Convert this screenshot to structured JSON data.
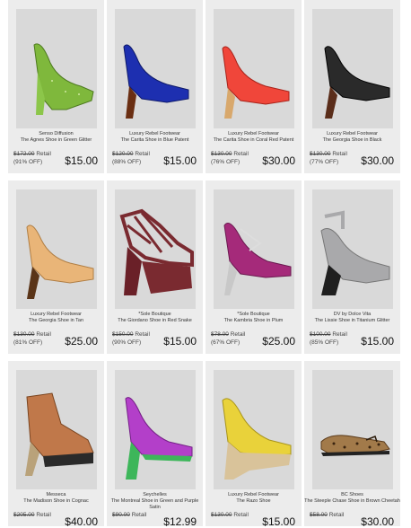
{
  "products": [
    {
      "brand": "Senso Diffusion",
      "name": "The Agnes Shoe in Green Glitter",
      "was": "$172.00",
      "retail_label": "Retail",
      "off": "(91% OFF)",
      "price": "$15.00",
      "shoe": "green-glitter-pump",
      "color": "#7fb83c"
    },
    {
      "brand": "Luxury Rebel Footwear",
      "name": "The Carita Shoe in Blue Patent",
      "was": "$120.00",
      "retail_label": "Retail",
      "off": "(88% OFF)",
      "price": "$15.00",
      "shoe": "blue-patent-pump",
      "color": "#1d2fb0"
    },
    {
      "brand": "Luxury Rebel Footwear",
      "name": "The Carita Shoe in Coral Red Patent",
      "was": "$130.00",
      "retail_label": "Retail",
      "off": "(76% OFF)",
      "price": "$30.00",
      "shoe": "coral-patent-pump",
      "color": "#f0463a"
    },
    {
      "brand": "Luxury Rebel Footwear",
      "name": "The Georgia Shoe in Black",
      "was": "$130.00",
      "retail_label": "Retail",
      "off": "(77% OFF)",
      "price": "$30.00",
      "shoe": "black-pump",
      "color": "#2a2a2a"
    },
    {
      "brand": "Luxury Rebel Footwear",
      "name": "The Georgia Shoe in Tan",
      "was": "$130.00",
      "retail_label": "Retail",
      "off": "(81% OFF)",
      "price": "$25.00",
      "shoe": "tan-pump",
      "color": "#e9b578"
    },
    {
      "brand": "*Sole Boutique",
      "name": "The Giordano Shoe in Red Snake",
      "was": "$150.00",
      "retail_label": "Retail",
      "off": "(90% OFF)",
      "price": "$15.00",
      "shoe": "red-snake-strappy-platform",
      "color": "#7a2a30"
    },
    {
      "brand": "*Sole Boutique",
      "name": "The Kambria Shoe in Plum",
      "was": "$78.00",
      "retail_label": "Retail",
      "off": "(67% OFF)",
      "price": "$25.00",
      "shoe": "plum-heel",
      "color": "#a52a7a"
    },
    {
      "brand": "DV by Dolce Vita",
      "name": "The Lissie Shoe in Titanium Glitter",
      "was": "$100.00",
      "retail_label": "Retail",
      "off": "(85% OFF)",
      "price": "$15.00",
      "shoe": "titanium-glitter-platform",
      "color": "#a9a9ab"
    },
    {
      "brand": "Messeca",
      "name": "The Madison Shoe in Cognac",
      "was": "$205.00",
      "retail_label": "Retail",
      "off": "",
      "price": "$40.00",
      "shoe": "cognac-bootie",
      "color": "#c0784a"
    },
    {
      "brand": "Seychelles",
      "name": "The Montreal Shoe in Green and Purple Satin",
      "was": "$90.00",
      "retail_label": "Retail",
      "off": "",
      "price": "$12.99",
      "shoe": "purple-satin-pump",
      "color": "#b33fc9"
    },
    {
      "brand": "Luxury Rebel Footwear",
      "name": "The Razo Shoe",
      "was": "$130.00",
      "retail_label": "Retail",
      "off": "",
      "price": "$15.00",
      "shoe": "yellow-wedge",
      "color": "#e9d23a"
    },
    {
      "brand": "BC Shoes",
      "name": "The Steeple Chase Shoe in Brown Cheetah",
      "was": "$58.00",
      "retail_label": "Retail",
      "off": "",
      "price": "$30.00",
      "shoe": "cheetah-flat",
      "color": "#a27a4a"
    }
  ]
}
